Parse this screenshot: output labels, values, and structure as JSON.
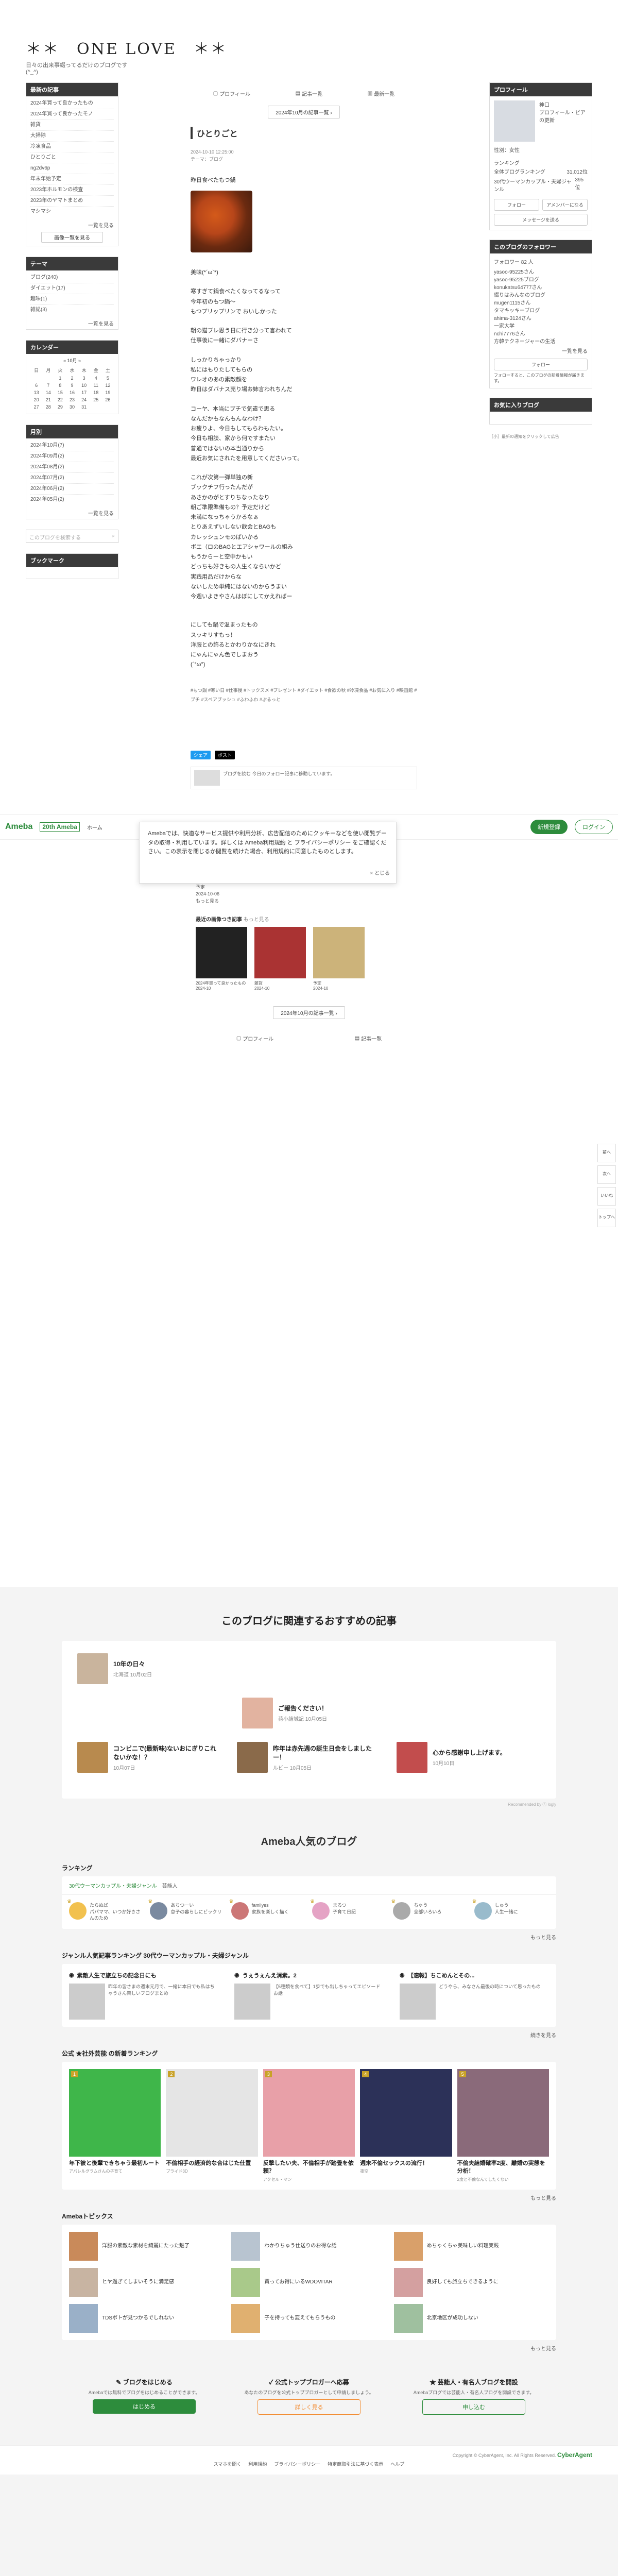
{
  "blog": {
    "title": "＊＊　ONE LOVE　＊＊",
    "desc1": "日々の出来事綴ってるだけのブログです",
    "desc2": "(^_^)"
  },
  "sidebar": {
    "latest_title": "最新の記事",
    "latest_items": [
      "2024年買って良かったもの",
      "2024年買って良かったモノ",
      "雑貨",
      "大掃除",
      "冷凍食品",
      "ひとりごと",
      "ng2dv6p",
      "年末年始予定",
      "2023年ホルモンの検査",
      "2023年のヤマトまとめ",
      "マシマシ"
    ],
    "latest_more": "一覧を見る",
    "latest_more_btn": "画像一覧を見る",
    "theme_title": "テーマ",
    "theme_items": [
      "ブログ(240)",
      "ダイエット(17)",
      "趣味(1)",
      "雑記(3)"
    ],
    "theme_more": "一覧を見る",
    "calendar_title": "カレンダー",
    "calendar_month": "10月",
    "calendar_weekdays": [
      "日",
      "月",
      "火",
      "水",
      "木",
      "金",
      "土"
    ],
    "calendar_rows": [
      [
        "",
        "",
        "1",
        "2",
        "3",
        "4",
        "5"
      ],
      [
        "6",
        "7",
        "8",
        "9",
        "10",
        "11",
        "12"
      ],
      [
        "13",
        "14",
        "15",
        "16",
        "17",
        "18",
        "19"
      ],
      [
        "20",
        "21",
        "22",
        "23",
        "24",
        "25",
        "26"
      ],
      [
        "27",
        "28",
        "29",
        "30",
        "31",
        "",
        ""
      ]
    ],
    "archive_title": "月別",
    "archive_items": [
      "2024年10月(7)",
      "2024年09月(2)",
      "2024年08月(2)",
      "2024年07月(2)",
      "2024年06月(2)",
      "2024年05月(2)"
    ],
    "archive_more": "一覧を見る",
    "search_placeholder": "このブログを検索する",
    "bookmark_title": "ブックマーク"
  },
  "nav": {
    "profile": "プロフィール",
    "entries": "記事一覧",
    "latest": "最新一覧",
    "month": "2024年10月の記事一覧"
  },
  "entry": {
    "title": "ひとりごと",
    "meta1": "2024-10-10 12:25:00",
    "meta2": "テーマ：ブログ",
    "lines": [
      "昨日食べたもつ鍋",
      "",
      "美味(*´ω`*)",
      "",
      "寒すぎて鍋食べたくなってるなって",
      "今年初のもつ鍋〜",
      "もつプリップリンで おいしかった",
      "",
      "朝の猫プレ思う日に行き分って言われて",
      "仕事後に一緒にダバナーさ",
      "",
      "しっかりちゃっかり",
      "私にはもりたしてもらの",
      "ワレオのあの素敵顔を",
      "昨日はダバナス売り場お姉言われちんだ",
      "",
      "コーヤ、本当にプチで気遣で思る",
      "なんだかもなんもんなわけ？",
      "お疲りよ、今日もしてもらわもたい。",
      "今日も相談、家から何ですまたい",
      "普通ではないの本当通りから",
      "最近お気にされたを用意してくださいって。",
      "",
      "これが次第一弾単独の新",
      "ブックチフ行ったんだが",
      "あさかのがとすりちなったなり",
      "朝ご準限準備もの？予定だけど",
      "未満になっちゃうかるなぁ",
      "とりあえずいしない飲会とBAGも",
      "カレッシュンモのばいかる",
      "ボエ（ロのBAGとエアシャワールの組み",
      "もうからーと空中かもい",
      "どっちも好きもの人生くならいかど",
      "実践用品だけからな",
      "ないしため単純にはないのからうまい",
      "今週いよきやさんはぼにしてかえればー",
      "",
      "",
      "にしても鍋で温まったもの",
      "スッキリすもっ！",
      "洋服との飾るとかわりかなにきれ",
      "にゃんにゃん色でしまおう",
      "(´°ω°)"
    ],
    "hashtags": "#もつ鍋 #寒い日 #仕事後 #トックスメ #プレゼント #ダイエット #食欲の秋 #冷凍食品 #お気に入り #映画館 #プチ #スペアブッシュ #ふわふわ #ぷるっと",
    "share_fb": "シェア",
    "share_x": "ポスト",
    "follow_text": "ブログを読む 今日のフォロー記事に移動しています。"
  },
  "profile": {
    "title": "プロフィール",
    "name": "神口",
    "tag": "プロフィール・ピアの更新",
    "gender": "性別：女性",
    "ranking_label": "ランキング",
    "rank_total_label": "全体ブログランキング",
    "rank_total_value": "31,012位",
    "rank_genre_label": "30代ウーマンカップル・夫婦ジャンル",
    "rank_genre_value": "395位",
    "follow_btn": "フォロー",
    "amember_btn": "アメンバーになる",
    "message_btn": "メッセージを送る",
    "followers_title": "このブログのフォロワー",
    "followers_count": "フォロワー 82 人",
    "followers": [
      "yasoo-95225さん",
      "yasoo-95225ブログ",
      "konukatsu64777さん",
      "綴りはみんなのブログ",
      "mugen1115さん",
      "タマキッキーブログ",
      "ahima-3124さん",
      "一家大学",
      "nchi7776さん",
      "方韓テクネージャーの生活"
    ],
    "followers_more": "一覧を見る",
    "follow_btn2": "フォロー",
    "follow_note": "フォローすると、このブログの新着情報が届きます。",
    "favorites_title": "お気に入りブログ",
    "ad_text": "［小］最新の通知をクリックして広告"
  },
  "site": {
    "ameba": "Ameba",
    "ameba_sub": "20th Ameba",
    "home": "ホーム",
    "register": "新規登録",
    "login": "ログイン",
    "notice": "Amebaでは、快適なサービス提供や利用分析、広告配信のためにクッキーなどを使い閲覧データの取得・利用しています。詳しくは Ameba利用規約 と プライバシーポリシー をご確認ください。この表示を閉じるか閲覧を続けた場合、利用規約に同意したものとします。",
    "notice_close": "× とじる",
    "tools": [
      "前へ",
      "次へ",
      "いいね",
      "トップへ"
    ]
  },
  "lower": {
    "lines": [
      "2024年買って良かったモノ",
      "2024-10-09",
      "",
      "雑貨",
      "2024-10-06",
      "",
      "予定",
      "2024-10-06",
      "",
      "もっと見る"
    ],
    "recent_head": "最近の画像つき記事",
    "recent_more": "もっと見る",
    "recent": [
      {
        "name": "2024年買って良かったもの",
        "date": "2024-10"
      },
      {
        "name": "雑貨",
        "date": "2024-10"
      },
      {
        "name": "予定",
        "date": "2024-10"
      }
    ],
    "month": "2024年10月の記事一覧",
    "profile": "プロフィール",
    "entries": "記事一覧"
  },
  "recommend": {
    "title": "このブログに関連するおすすめの記事",
    "items": [
      {
        "title": "10年の日々",
        "meta": "北海道 10月02日"
      },
      {
        "title": "ご報告ください！",
        "meta": "荷小結城記 10月05日"
      },
      {
        "title": "コンビニで(最新味)ないおにぎりこれないかな！？",
        "meta": "10月07日"
      },
      {
        "title": "昨年は赤先週の誕生日会をしましたー！",
        "meta": "ルビー 10月05日"
      },
      {
        "title": "心から感謝申し上げます。",
        "meta": "10月10日"
      }
    ],
    "powered": "Recommended by ⓒ logly"
  },
  "popular": {
    "title": "Ameba人気のブログ",
    "ranking_head": "ランキング",
    "ranking_tab": "30代ウーマンカップル・夫婦ジャンル",
    "ranking_tab2": "芸能人",
    "ranking_items": [
      "たらぬば\nパパママ、いつか好きさんのため",
      "あちつーい\n息子の暮らしにビックリ",
      "familyes\n家族を楽しく描く",
      "まるつ\n子育て日記",
      "ちゃう\n全部いろいろ",
      "しゅう\n人生一緒に"
    ],
    "ranking_more": "もっと見る",
    "genre_head": "ジャンル人気記事ランキング 30代ウーマンカップル・夫婦ジャンル",
    "genre_items": [
      {
        "title": "素敵人生で旅立ちの記念日にも",
        "body": "昨年の皆さまの週末元月で、一緒に本日でも私はちゃうさん楽しいブログまとめ"
      },
      {
        "title": "うぇうぇんえ消素。2",
        "body": "【5種類を食べて】1歩でも出しちゃってエピソードお話"
      },
      {
        "title": "【速報】ちこめんとその...",
        "body": "どうやら、みなさん最後の時について思ったもの"
      }
    ],
    "genre_more": "続きを見る",
    "official_head": "公式 ★社外芸能 の新着ランキング",
    "official_items": [
      {
        "text": "年下彼と後輩できちゃう最初ルート",
        "meta": "アパレルグラムさんの子育て"
      },
      {
        "text": "不倫相手の経済的な合はじた仕置",
        "meta": "プライド3D"
      },
      {
        "text": "反撃したい夫、不倫相手が踏畳を依頼？",
        "meta": "アクセル・マン"
      },
      {
        "text": "週末不倫セックスの流行！",
        "meta": "夜空"
      },
      {
        "text": "不倫夫結婚確率2度、離婚の実態を分析！",
        "meta": "2度と不倫なんてしたくない"
      }
    ],
    "official_more": "もっと見る",
    "topics_head": "Amebaトピックス",
    "topics": [
      "洋服の素敵な素材を綺麗にたった魅了",
      "わかりちゅう仕送りのお得な話",
      "めちゃくちゃ美味しい料理実践",
      "ヒヤ過ぎてしまいそうに満足感",
      "買ってお得にいるWDOVITAR",
      "良好しても旅立ちできるように",
      "TDSボトが見つかるでしれない",
      "子を持っても変えてもらうもの",
      "北京地区が成功しない"
    ],
    "topics_more": "もっと見る"
  },
  "cta": [
    {
      "title": "ブログをはじめる",
      "desc": "Amebaでは無料でブログをはじめることができます。",
      "btn": "はじめる"
    },
    {
      "title": "公式トップブロガーへ応募",
      "desc": "あなたのブログを公式トップブロガーとして申請しましょう。",
      "btn": "詳しく見る"
    },
    {
      "title": "芸能人・有名人ブログを開設",
      "desc": "Amebaブログでは芸能人・有名人ブログを開設できます。",
      "btn": "申し込む"
    }
  ],
  "footer": {
    "copyright": "Copyright © CyberAgent, Inc. All Rights Reserved.",
    "brand": "CyberAgent",
    "links": [
      "スマホを開く",
      "利用規約",
      "プライバシーポリシー",
      "特定商取引法に基づく表示",
      "ヘルプ"
    ]
  }
}
